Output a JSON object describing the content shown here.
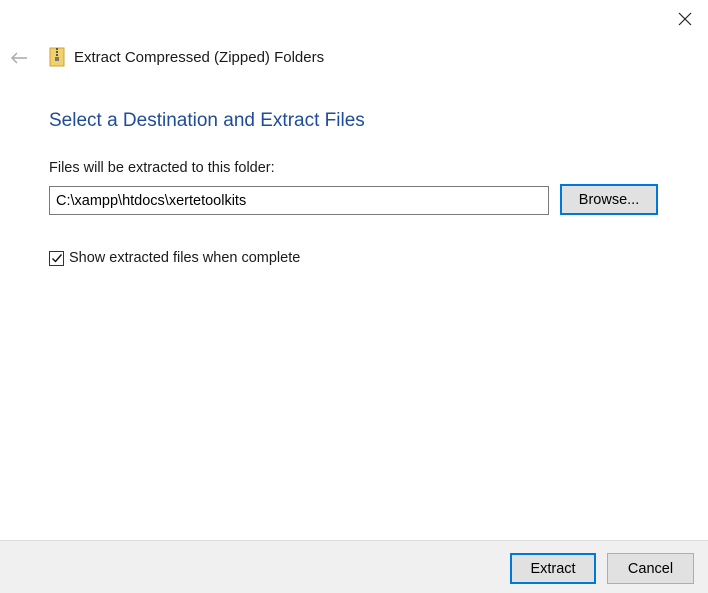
{
  "window": {
    "close_icon": "close-icon"
  },
  "header": {
    "back_icon": "back-arrow-icon",
    "folder_icon": "zipped-folder-icon",
    "title": "Extract Compressed (Zipped) Folders"
  },
  "main": {
    "heading": "Select a Destination and Extract Files",
    "destination_label": "Files will be extracted to this folder:",
    "destination_value": "C:\\xampp\\htdocs\\xertetoolkits",
    "browse_label": "Browse...",
    "show_files_checked": true,
    "show_files_label": "Show extracted files when complete"
  },
  "footer": {
    "extract_label": "Extract",
    "cancel_label": "Cancel"
  },
  "colors": {
    "heading": "#1f4b99",
    "accent": "#0078d7",
    "footer_bg": "#f0f0f0"
  }
}
